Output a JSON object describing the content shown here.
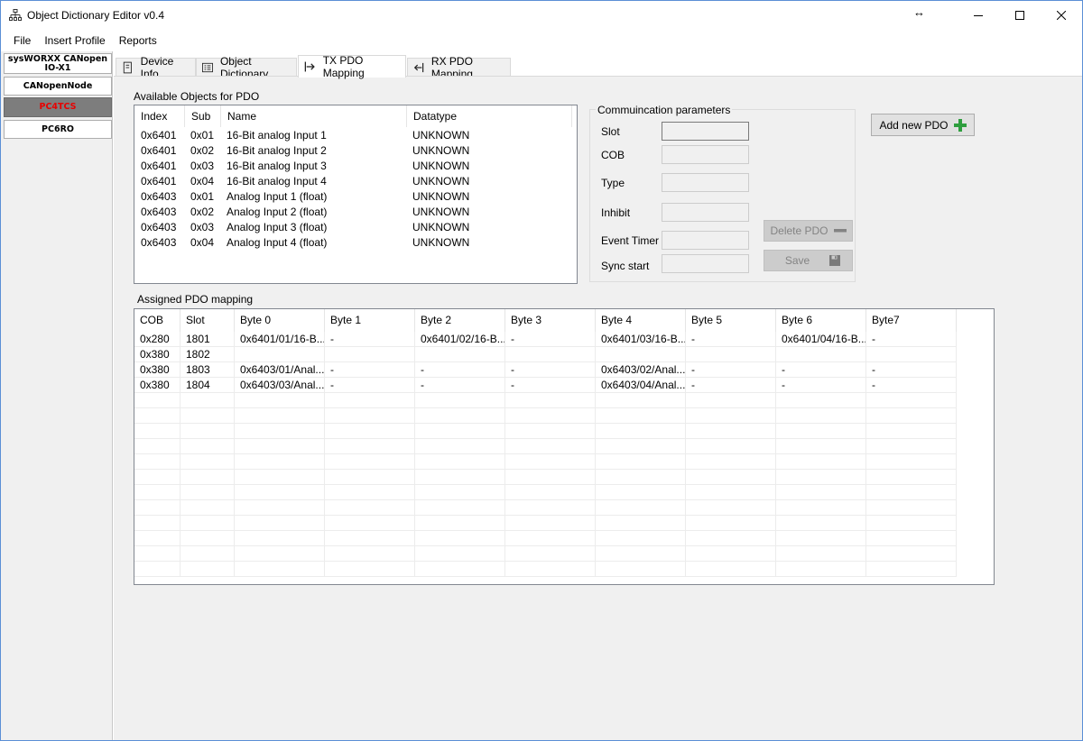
{
  "window": {
    "title": "Object Dictionary Editor v0.4",
    "resize_glyph": "↔"
  },
  "menu": [
    "File",
    "Insert Profile",
    "Reports"
  ],
  "devices": [
    {
      "label": "sysWORXX CANopen IO-X1",
      "selected": false
    },
    {
      "label": "CANopenNode",
      "selected": false
    },
    {
      "label": "PC4TCS",
      "selected": true
    },
    {
      "label": "PC6RO",
      "selected": false
    }
  ],
  "tabs": [
    {
      "label": "Device Info",
      "icon": "device-info-icon",
      "active": false
    },
    {
      "label": "Object Dictionary",
      "icon": "object-dictionary-icon",
      "active": false
    },
    {
      "label": "TX PDO Mapping",
      "icon": "tx-arrow-icon",
      "active": true
    },
    {
      "label": "RX PDO Mapping",
      "icon": "rx-arrow-icon",
      "active": false
    }
  ],
  "available": {
    "title": "Available Objects for PDO",
    "columns": [
      "Index",
      "Sub",
      "Name",
      "Datatype"
    ],
    "rows": [
      [
        "0x6401",
        "0x01",
        "16-Bit analog Input 1",
        "UNKNOWN"
      ],
      [
        "0x6401",
        "0x02",
        "16-Bit analog Input 2",
        "UNKNOWN"
      ],
      [
        "0x6401",
        "0x03",
        "16-Bit analog Input 3",
        "UNKNOWN"
      ],
      [
        "0x6401",
        "0x04",
        "16-Bit analog Input 4",
        "UNKNOWN"
      ],
      [
        "0x6403",
        "0x01",
        "Analog Input 1 (float)",
        "UNKNOWN"
      ],
      [
        "0x6403",
        "0x02",
        "Analog Input 2 (float)",
        "UNKNOWN"
      ],
      [
        "0x6403",
        "0x03",
        "Analog Input 3 (float)",
        "UNKNOWN"
      ],
      [
        "0x6403",
        "0x04",
        "Analog Input 4 (float)",
        "UNKNOWN"
      ]
    ]
  },
  "comm": {
    "title": "Commuincation parameters",
    "fields": [
      {
        "label": "Slot",
        "value": ""
      },
      {
        "label": "COB",
        "value": ""
      },
      {
        "label": "Type",
        "value": ""
      },
      {
        "label": "Inhibit",
        "value": ""
      },
      {
        "label": "Event Timer",
        "value": ""
      },
      {
        "label": "Sync start",
        "value": ""
      }
    ],
    "delete_label": "Delete PDO",
    "save_label": "Save"
  },
  "add_pdo_label": "Add new PDO",
  "assigned": {
    "title": "Assigned PDO mapping",
    "columns": [
      "COB",
      "Slot",
      "Byte 0",
      "Byte 1",
      "Byte 2",
      "Byte 3",
      "Byte 4",
      "Byte 5",
      "Byte 6",
      "Byte7"
    ],
    "rows": [
      [
        "0x280",
        "1801",
        "0x6401/01/16-B...",
        "-",
        "0x6401/02/16-B...",
        "-",
        "0x6401/03/16-B...",
        "-",
        "0x6401/04/16-B...",
        "-"
      ],
      [
        "0x380",
        "1802",
        "",
        "",
        "",
        "",
        "",
        "",
        "",
        ""
      ],
      [
        "0x380",
        "1803",
        "0x6403/01/Anal...",
        "-",
        "-",
        "-",
        "0x6403/02/Anal...",
        "-",
        "-",
        "-"
      ],
      [
        "0x380",
        "1804",
        "0x6403/03/Anal...",
        "-",
        "-",
        "-",
        "0x6403/04/Anal...",
        "-",
        "-",
        "-"
      ]
    ],
    "empty_rows": 12
  },
  "colors": {
    "selected_device_bg": "#7d7d7d",
    "selected_device_text": "#e80000",
    "plus_icon": "#2e9e3e"
  }
}
